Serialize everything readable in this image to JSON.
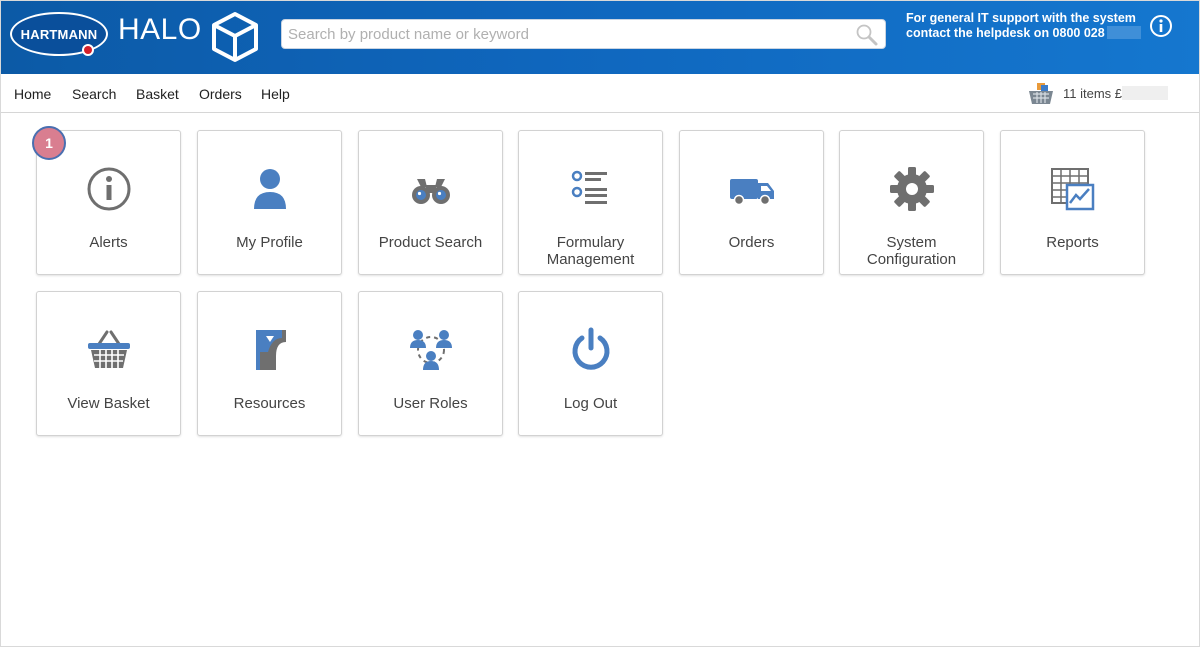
{
  "header": {
    "logo_text": "HARTMANN",
    "app_name": "HALO",
    "search_placeholder": "Search by product name or keyword",
    "support_line1": "For general IT support with the system",
    "support_line2": "contact the helpdesk on 0800 028"
  },
  "nav": {
    "items": [
      "Home",
      "Search",
      "Basket",
      "Orders",
      "Help"
    ],
    "basket_summary": "11 items £"
  },
  "tiles": [
    {
      "label": "Alerts",
      "icon": "info-circle-icon"
    },
    {
      "label": "My Profile",
      "icon": "user-icon"
    },
    {
      "label": "Product Search",
      "icon": "binoculars-icon"
    },
    {
      "label_line1": "Formulary",
      "label_line2": "Management",
      "icon": "list-icon"
    },
    {
      "label": "Orders",
      "icon": "truck-icon"
    },
    {
      "label_line1": "System",
      "label_line2": "Configuration",
      "icon": "gear-icon"
    },
    {
      "label": "Reports",
      "icon": "report-chart-icon"
    },
    {
      "label": "View Basket",
      "icon": "basket-icon"
    },
    {
      "label": "Resources",
      "icon": "book-icon"
    },
    {
      "label": "User Roles",
      "icon": "user-group-icon"
    },
    {
      "label": "Log Out",
      "icon": "power-icon"
    }
  ],
  "alerts_count": "1",
  "colors": {
    "header_blue": "#0f66bd",
    "icon_blue": "#4a7fc1",
    "icon_grey": "#6f6f6f",
    "badge_pink": "#d97e90"
  }
}
